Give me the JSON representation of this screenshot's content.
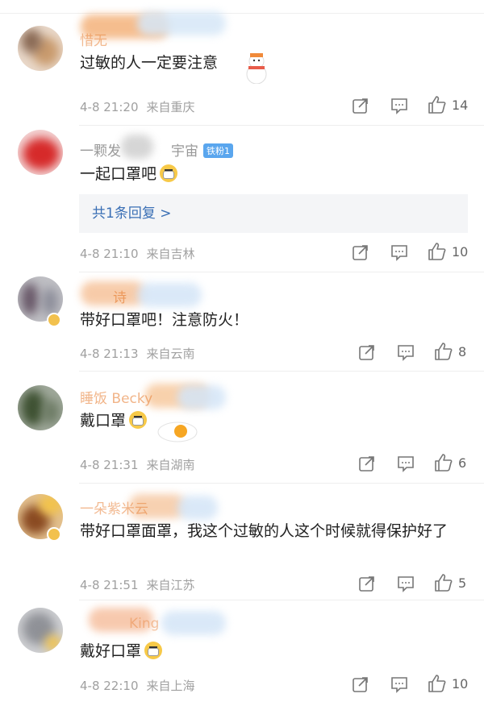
{
  "comments": [
    {
      "username": "惜无",
      "level": "",
      "text": "过敏的人一定要注意",
      "time": "4-8 21:20",
      "location": "来自重庆",
      "likes": "14"
    },
    {
      "username": "一颗发",
      "username_tail": "宇宙",
      "level": "铁粉1",
      "text": "一起口罩吧",
      "reply_label": "共1条回复 >",
      "time": "4-8 21:10",
      "location": "来自吉林",
      "likes": "10"
    },
    {
      "username": "诗",
      "level": "",
      "text": "带好口罩吧！注意防火！",
      "time": "4-8 21:13",
      "location": "来自云南",
      "likes": "8"
    },
    {
      "username": "睡饭 Becky",
      "level": "",
      "text": "戴口罩",
      "time": "4-8 21:31",
      "location": "来自湖南",
      "likes": "6"
    },
    {
      "username": "一朵紫米云",
      "level": "",
      "text": "带好口罩面罩，我这个过敏的人这个时候就得保护好了",
      "time": "4-8 21:51",
      "location": "来自江苏",
      "likes": "5"
    },
    {
      "username": "King",
      "level": "",
      "text": "戴好口罩",
      "time": "4-8 22:10",
      "location": "来自上海",
      "likes": "10"
    }
  ],
  "icons": {
    "share": "share-icon",
    "comment": "comment-icon",
    "like": "thumbs-up-icon"
  },
  "colors": {
    "username": "#e8833a",
    "reply_link": "#3a6fb5",
    "meta": "#a0a0a0"
  }
}
